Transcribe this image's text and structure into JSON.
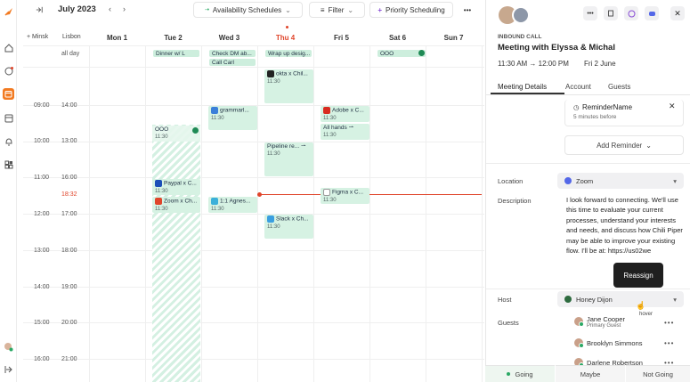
{
  "toolbar": {
    "month_label": "July 2023",
    "availability_label": "Availability Schedules",
    "filter_label": "Filter",
    "priority_label": "Priority Scheduling"
  },
  "calendar": {
    "add_tz": "+ Minsk",
    "tz2": "Lisbon",
    "days": [
      "Mon 1",
      "Tue 2",
      "Wed 3",
      "Thu 4",
      "Fri 5",
      "Sat 6",
      "Sun 7"
    ],
    "all_day": "all day",
    "times_left": [
      "09:00",
      "10:00",
      "11:00",
      "12:00",
      "13:00",
      "14:00",
      "15:00",
      "16:00"
    ],
    "times_right": [
      "14:00",
      "13:00",
      "16:00",
      "17:00",
      "18:00",
      "19:00",
      "20:00",
      "21:00"
    ],
    "now_label": "18:32",
    "allday_events": {
      "tue": "Dinner w/ L",
      "wed1": "Check DM ab...",
      "wed2": "Call Carl",
      "thu": "Wrap up desig...",
      "sat": "OOO"
    },
    "events": {
      "okta": "okta x Chil...",
      "okta_t": "11:30",
      "gram": "grammarl...",
      "gram_t": "11:30",
      "adobe": "Adobe x C...",
      "adobe_t": "11:30",
      "allhands": "All hands",
      "allhands_t": "11:30",
      "ooo": "OOO",
      "ooo_t": "11:30",
      "pipeline": "Pipeline re...",
      "pipeline_t": "11:30",
      "paypal": "Paypal x C...",
      "paypal_t": "11:30",
      "figma": "Figma x C...",
      "figma_t": "11:30",
      "zoom": "Zoom x Ch...",
      "zoom_t": "11:30",
      "agnes": "1:1 Agnes...",
      "agnes_t": "11:30",
      "slack": "Slack x Ch...",
      "slack_t": "11:30"
    }
  },
  "panel": {
    "type_label": "INBOUND CALL",
    "title": "Meeting with Elyssa & Michal",
    "time": "11:30 AM  →  12:00 PM",
    "date": "Fri 2 June",
    "tabs": [
      "Meeting Details",
      "Account",
      "Guests"
    ],
    "reminder_name": "ReminderName",
    "reminder_sub": "5 minutes before",
    "add_reminder": "Add Reminder",
    "location_label": "Location",
    "location_value": "Zoom",
    "description_label": "Description",
    "description_text": "I look forward to connecting. We'll use this time to evaluate your current processes, understand your interests and needs, and discuss how Chili Piper may be able to improve your existing flow. I'll be at: https://us02we",
    "reassign_label": "Reassign",
    "host_label": "Host",
    "host_value": "Honey Dijon",
    "hover_label": "hover",
    "guests_label": "Guests",
    "guests": [
      {
        "name": "Jane Cooper",
        "sub": "Primary Guest"
      },
      {
        "name": "Brooklyn Simmons",
        "sub": ""
      },
      {
        "name": "Darlene Robertson",
        "sub": ""
      }
    ],
    "footer": [
      "Going",
      "Maybe",
      "Not Going"
    ]
  }
}
